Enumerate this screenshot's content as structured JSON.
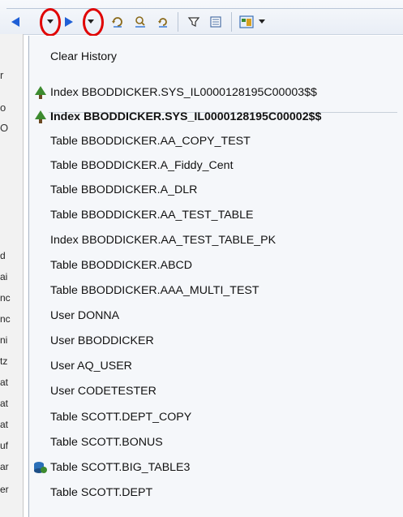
{
  "history_menu": {
    "clear_label": "Clear History",
    "items": [
      {
        "label": "Index BBODDICKER.SYS_IL0000128195C00003$$",
        "icon": "tree-icon",
        "bold": false
      },
      {
        "label": "Index BBODDICKER.SYS_IL0000128195C00002$$",
        "icon": "tree-icon",
        "bold": true
      },
      {
        "label": "Table BBODDICKER.AA_COPY_TEST",
        "icon": "",
        "bold": false
      },
      {
        "label": "Table BBODDICKER.A_Fiddy_Cent",
        "icon": "",
        "bold": false
      },
      {
        "label": "Table BBODDICKER.A_DLR",
        "icon": "",
        "bold": false
      },
      {
        "label": "Table BBODDICKER.AA_TEST_TABLE",
        "icon": "",
        "bold": false
      },
      {
        "label": "Index BBODDICKER.AA_TEST_TABLE_PK",
        "icon": "",
        "bold": false
      },
      {
        "label": "Table BBODDICKER.ABCD",
        "icon": "",
        "bold": false
      },
      {
        "label": "Table BBODDICKER.AAA_MULTI_TEST",
        "icon": "",
        "bold": false
      },
      {
        "label": "User DONNA",
        "icon": "",
        "bold": false
      },
      {
        "label": "User BBODDICKER",
        "icon": "",
        "bold": false
      },
      {
        "label": "User AQ_USER",
        "icon": "",
        "bold": false
      },
      {
        "label": "User CODETESTER",
        "icon": "",
        "bold": false
      },
      {
        "label": "Table SCOTT.DEPT_COPY",
        "icon": "",
        "bold": false
      },
      {
        "label": "Table SCOTT.BONUS",
        "icon": "",
        "bold": false
      },
      {
        "label": "Table SCOTT.BIG_TABLE3",
        "icon": "database-table-icon",
        "bold": false
      },
      {
        "label": "Table SCOTT.DEPT",
        "icon": "",
        "bold": false
      }
    ]
  },
  "colors": {
    "arrow_blue": "#1f5fd6",
    "highlight_red": "#e00000",
    "tree_green": "#3d8b2f"
  },
  "toolbar": {
    "icons": [
      "back-arrow-icon",
      "dropdown-arrow-icon",
      "forward-arrow-icon",
      "dropdown-arrow-icon",
      "refresh-icon",
      "find-refresh-icon",
      "refresh-object-icon",
      "filter-icon",
      "properties-icon",
      "view-menu-icon"
    ]
  },
  "left_strip": {
    "fragments": [
      "r",
      "o",
      "O",
      "d",
      "ai",
      "nc",
      "nc",
      "ni",
      "tz",
      "at",
      "at",
      "at",
      "uf",
      "ar",
      "er"
    ]
  }
}
